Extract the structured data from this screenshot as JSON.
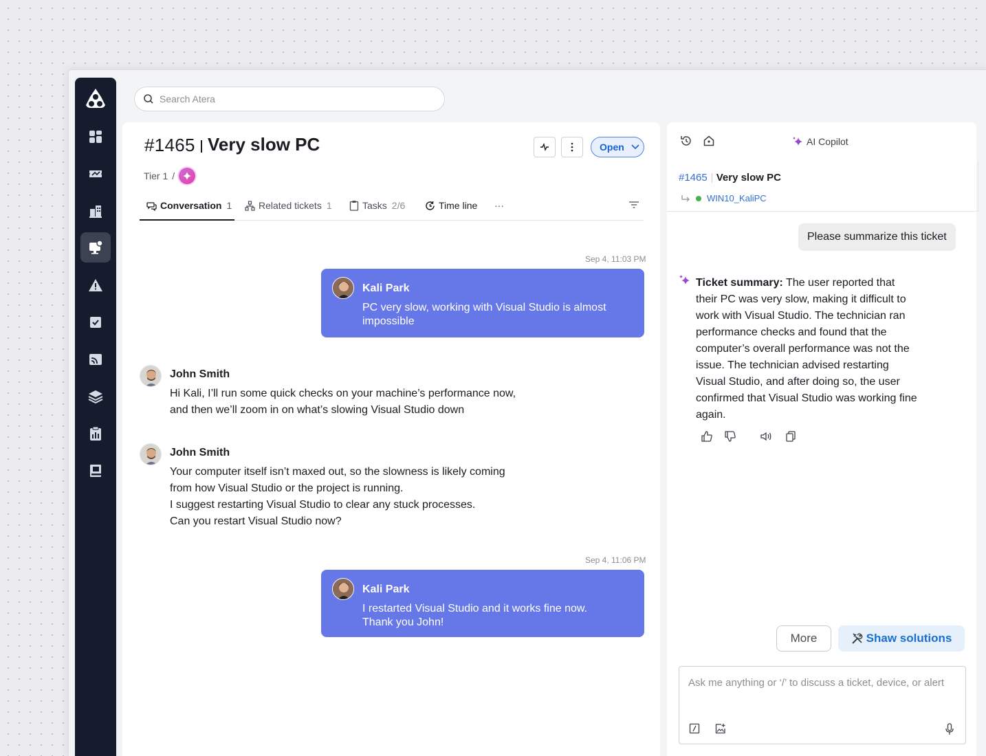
{
  "search": {
    "placeholder": "Search Atera"
  },
  "sidebar": {
    "items": [
      {
        "icon": "dashboard-icon"
      },
      {
        "icon": "tickets-icon"
      },
      {
        "icon": "customers-icon"
      },
      {
        "icon": "devices-icon",
        "active": true
      },
      {
        "icon": "alerts-icon"
      },
      {
        "icon": "patch-icon"
      },
      {
        "icon": "feeds-icon"
      },
      {
        "icon": "software-icon"
      },
      {
        "icon": "reports-icon"
      },
      {
        "icon": "knowledge-base-icon"
      }
    ]
  },
  "ticket": {
    "id": "#1465",
    "title": "Very slow PC",
    "tier": "Tier 1",
    "tier_sep": "/",
    "status": "Open"
  },
  "tabs": [
    {
      "label": "Conversation",
      "count": "1",
      "icon": "conversation-icon",
      "active": true
    },
    {
      "label": "Related tickets",
      "count": "1",
      "icon": "related-icon"
    },
    {
      "label": "Tasks",
      "count": "2/6",
      "icon": "clipboard-icon"
    },
    {
      "label": "Time line",
      "icon": "timeline-icon"
    },
    {
      "label": "···"
    }
  ],
  "conversation": [
    {
      "type": "time",
      "text": "Sep 4, 11:03 PM"
    },
    {
      "type": "bubble",
      "author": "Kali Park",
      "text": "PC very slow, working with Visual Studio is almost impossible"
    },
    {
      "type": "msg",
      "author": "John Smith",
      "lines": [
        "Hi Kali, I’ll run some quick checks on your machine’s performance now,",
        "and then we’ll zoom in on what’s slowing Visual Studio down"
      ]
    },
    {
      "type": "msg",
      "author": "John Smith",
      "lines": [
        "Your computer itself isn’t maxed out, so the slowness is likely coming",
        "from how Visual Studio or the project is running.",
        "I suggest restarting Visual Studio to clear any stuck processes.",
        "Can you restart Visual Studio now?"
      ]
    },
    {
      "type": "time",
      "text": "Sep 4, 11:06 PM"
    },
    {
      "type": "bubble",
      "author": "Kali Park",
      "lines": [
        "I restarted Visual Studio and it works fine now.",
        "Thank you John!"
      ]
    }
  ],
  "copilot": {
    "title": "AI Copilot",
    "ticket_id": "#1465",
    "ticket_title": "Very slow PC",
    "device": "WIN10_KaliPC",
    "user_question": "Please summarize this ticket",
    "summary_label": "Ticket summary:",
    "summary_text": "The user reported that their PC was very slow, making it difficult to work with Visual Studio. The technician ran performance checks and found that the computer’s overall performance was not the issue. The technician advised restarting Visual Studio, and after doing so, the user confirmed that Visual Studio was working fine again.",
    "more_label": "More",
    "solutions_label": "Shaw solutions",
    "composer_placeholder": "Ask me anything or ‘/’  to discuss a ticket, device, or alert"
  },
  "colors": {
    "sidebar_bg": "#141c2e",
    "bubble_bg": "#6678e8",
    "status_blue": "#1a5fcf",
    "online_green": "#4caf50",
    "ai_sparkle": "#7b3fe4"
  }
}
